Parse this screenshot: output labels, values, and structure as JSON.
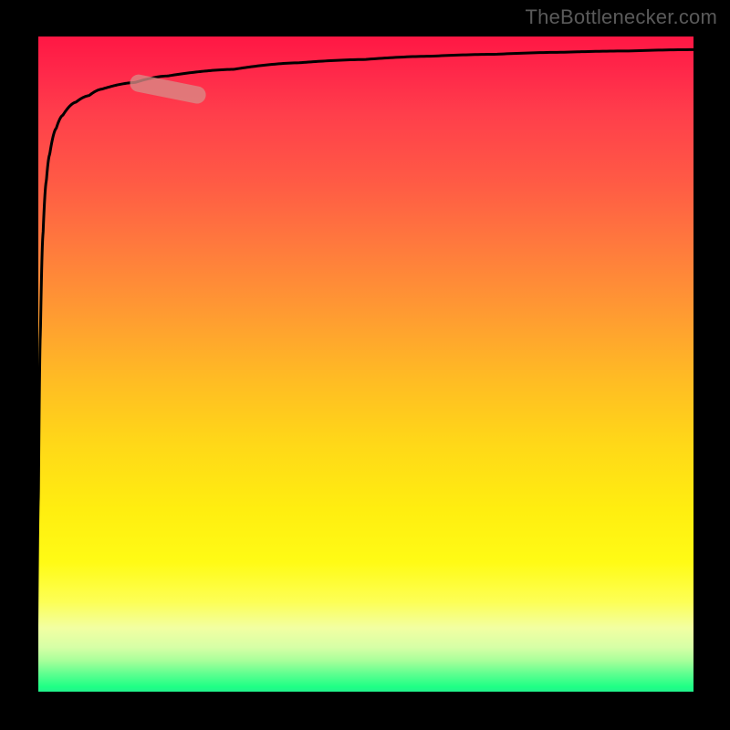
{
  "watermark": "TheBottlenecker.com",
  "colors": {
    "background": "#000000",
    "gradient_top": "#ff1744",
    "gradient_bottom": "#24ec8f",
    "curve_stroke": "#000000",
    "marker_fill": "#d88a86",
    "marker_opacity": 0.78
  },
  "chart_data": {
    "type": "line",
    "title": "",
    "xlabel": "",
    "ylabel": "",
    "xlim": [
      0,
      100
    ],
    "ylim": [
      0,
      100
    ],
    "grid": false,
    "legend": false,
    "x": [
      0.0,
      0.3,
      0.6,
      1.0,
      1.5,
      2.0,
      3.0,
      4.0,
      6.0,
      8.0,
      10.0,
      15.0,
      20.0,
      30.0,
      40.0,
      50.0,
      60.0,
      70.0,
      80.0,
      90.0,
      100.0
    ],
    "values": [
      0.0,
      30.0,
      55.0,
      70.0,
      78.0,
      82.0,
      86.0,
      88.0,
      90.0,
      91.0,
      92.0,
      93.0,
      94.0,
      95.0,
      96.0,
      96.5,
      97.0,
      97.3,
      97.6,
      97.8,
      98.0
    ],
    "marker": {
      "x_range": [
        15,
        25
      ],
      "y_range": [
        91,
        93
      ]
    },
    "background_gradient": {
      "axis": "y",
      "stops": [
        {
          "pos": 0,
          "color": "#24ec8f"
        },
        {
          "pos": 10,
          "color": "#f2ffa2"
        },
        {
          "pos": 30,
          "color": "#ffee10"
        },
        {
          "pos": 60,
          "color": "#ff9a32"
        },
        {
          "pos": 90,
          "color": "#ff2a4a"
        },
        {
          "pos": 100,
          "color": "#ff1744"
        }
      ]
    }
  }
}
